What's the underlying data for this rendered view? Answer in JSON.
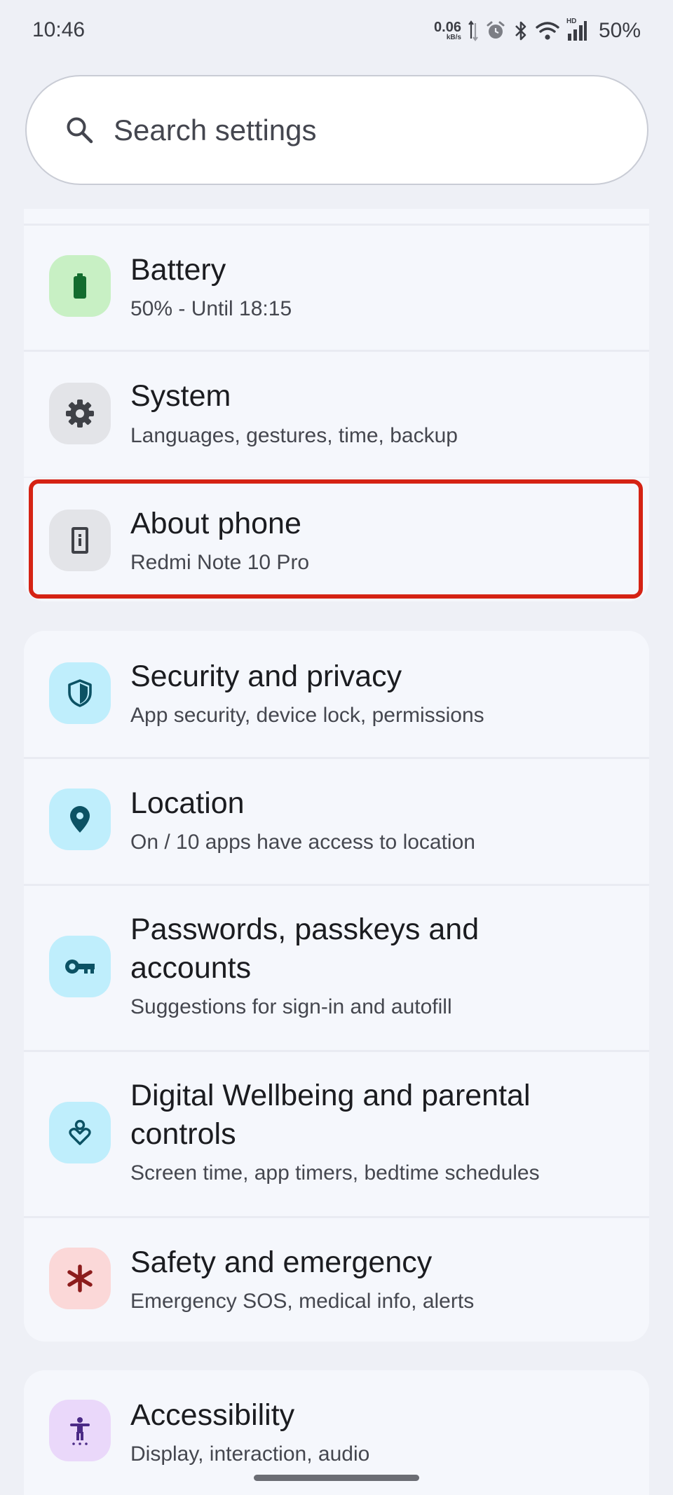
{
  "status_bar": {
    "time": "10:46",
    "net_speed_value": "0.06",
    "net_speed_unit": "kB/s",
    "network_label": "HD",
    "battery_percent": "50%"
  },
  "search": {
    "placeholder": "Search settings"
  },
  "settings": {
    "battery": {
      "title": "Battery",
      "subtitle": "50% - Until 18:15",
      "icon": "battery-icon",
      "icon_bg": "#c8f0c4",
      "icon_color": "#136c2e"
    },
    "system": {
      "title": "System",
      "subtitle": "Languages, gestures, time, backup",
      "icon": "gear-icon",
      "icon_bg": "#e3e4e8",
      "icon_color": "#3f4147"
    },
    "about_phone": {
      "title": "About phone",
      "subtitle": "Redmi Note 10 Pro",
      "icon": "phone-info-icon",
      "icon_bg": "#e3e4e8",
      "icon_color": "#3f4147"
    },
    "security": {
      "title": "Security and privacy",
      "subtitle": "App security, device lock, permissions",
      "icon": "shield-icon",
      "icon_bg": "#bfeefc",
      "icon_color": "#0c5264"
    },
    "location": {
      "title": "Location",
      "subtitle": "On / 10 apps have access to location",
      "icon": "location-pin-icon",
      "icon_bg": "#bfeefc",
      "icon_color": "#0c5264"
    },
    "passwords": {
      "title_line1": "Passwords, passkeys and",
      "title_line2": "accounts",
      "subtitle": "Suggestions for sign-in and autofill",
      "icon": "key-icon",
      "icon_bg": "#bfeefc",
      "icon_color": "#0c5264"
    },
    "wellbeing": {
      "title_line1": "Digital Wellbeing and parental",
      "title_line2": "controls",
      "subtitle": "Screen time, app timers, bedtime schedules",
      "icon": "wellbeing-heart-icon",
      "icon_bg": "#bfeefc",
      "icon_color": "#0c5264"
    },
    "safety": {
      "title": "Safety and emergency",
      "subtitle": "Emergency SOS, medical info, alerts",
      "icon": "asterisk-icon",
      "icon_bg": "#fbd8d8",
      "icon_color": "#8c1c1c"
    },
    "accessibility": {
      "title": "Accessibility",
      "subtitle": "Display, interaction, audio",
      "icon": "accessibility-icon",
      "icon_bg": "#ead8fa",
      "icon_color": "#4b2a86"
    }
  },
  "colors": {
    "background": "#eef0f6",
    "card": "#f5f7fc",
    "highlight": "#d52314"
  }
}
